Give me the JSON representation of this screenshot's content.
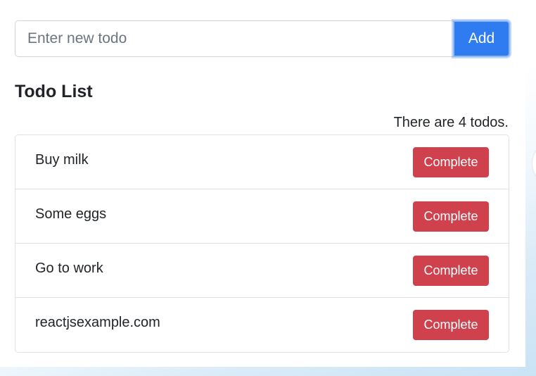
{
  "form": {
    "input_value": "",
    "input_placeholder": "Enter new todo",
    "add_label": "Add"
  },
  "list": {
    "heading": "Todo List",
    "count_text": "There are 4 todos.",
    "complete_label": "Complete",
    "items": [
      {
        "text": "Buy milk"
      },
      {
        "text": "Some eggs"
      },
      {
        "text": "Go to work"
      },
      {
        "text": "reactjsexample.com"
      }
    ]
  },
  "colors": {
    "primary": "#2f7bf0",
    "danger": "#d0414e"
  }
}
